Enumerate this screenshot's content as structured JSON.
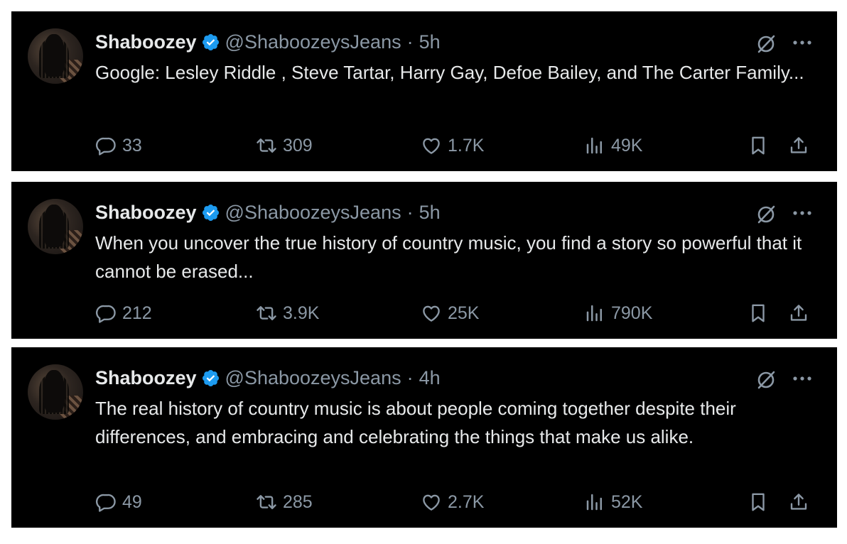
{
  "colors": {
    "background": "#000000",
    "text": "#e7e9ea",
    "muted": "#8b98a5",
    "verified": "#1d9bf0"
  },
  "tweets": [
    {
      "name": "Shaboozey",
      "handle": "@ShaboozeysJeans",
      "separator": "·",
      "time": "5h",
      "text": "Google: Lesley Riddle , Steve Tartar, Harry Gay, Defoe Bailey, and The Carter Family...",
      "replies": "33",
      "retweets": "309",
      "likes": "1.7K",
      "views": "49K"
    },
    {
      "name": "Shaboozey",
      "handle": "@ShaboozeysJeans",
      "separator": "·",
      "time": "5h",
      "text": "When you uncover the true history of country music, you find a story so powerful that it cannot be erased...",
      "replies": "212",
      "retweets": "3.9K",
      "likes": "25K",
      "views": "790K"
    },
    {
      "name": "Shaboozey",
      "handle": "@ShaboozeysJeans",
      "separator": "·",
      "time": "4h",
      "text": "The real history of country music is about people coming together despite their differences, and embracing and celebrating the things that make us alike.",
      "replies": "49",
      "retweets": "285",
      "likes": "2.7K",
      "views": "52K"
    }
  ],
  "icons": [
    "verified-badge-icon",
    "grok-icon",
    "more-icon",
    "reply-icon",
    "retweet-icon",
    "like-icon",
    "views-icon",
    "bookmark-icon",
    "share-icon"
  ]
}
